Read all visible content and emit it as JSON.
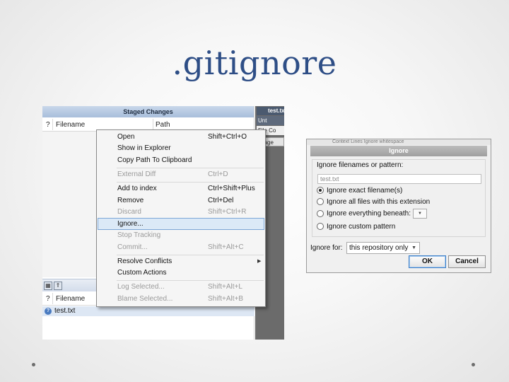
{
  "slide": {
    "title": ".gitignore"
  },
  "left_panel": {
    "staged_header": "Staged Changes",
    "col_q": "?",
    "col_filename": "Filename",
    "col_path": "Path",
    "unstaged_file": "test.txt",
    "right_strip": {
      "tab_label": "test.txt",
      "item_1": "Unt",
      "item_2": "File Co",
      "item_3": "Stage"
    }
  },
  "context_menu": {
    "items": [
      {
        "label": "Open",
        "shortcut": "Shift+Ctrl+O"
      },
      {
        "label": "Show in Explorer",
        "shortcut": ""
      },
      {
        "label": "Copy Path To Clipboard",
        "shortcut": ""
      },
      {
        "label": "External Diff",
        "shortcut": "Ctrl+D"
      },
      {
        "label": "Add to index",
        "shortcut": "Ctrl+Shift+Plus"
      },
      {
        "label": "Remove",
        "shortcut": "Ctrl+Del"
      },
      {
        "label": "Discard",
        "shortcut": "Shift+Ctrl+R"
      },
      {
        "label": "Ignore...",
        "shortcut": ""
      },
      {
        "label": "Stop Tracking",
        "shortcut": ""
      },
      {
        "label": "Commit...",
        "shortcut": "Shift+Alt+C"
      },
      {
        "label": "Resolve Conflicts",
        "shortcut": ""
      },
      {
        "label": "Custom Actions",
        "shortcut": ""
      },
      {
        "label": "Log Selected...",
        "shortcut": "Shift+Alt+L"
      },
      {
        "label": "Blame Selected...",
        "shortcut": "Shift+Alt+B"
      }
    ]
  },
  "ignore_dialog": {
    "background_strip": "Context     Lines     Ignore whitespace",
    "title": "Ignore",
    "group_label": "Ignore filenames or pattern:",
    "pattern_value": "test.txt",
    "option_exact": "Ignore exact filename(s)",
    "option_extension": "Ignore all files with this extension",
    "option_beneath": "Ignore everything beneath:",
    "option_custom": "Ignore custom pattern",
    "selected_option": "Ignore exact filename(s)",
    "ignore_for_label": "Ignore for:",
    "ignore_for_value": "this repository only",
    "ok_label": "OK",
    "cancel_label": "Cancel"
  }
}
